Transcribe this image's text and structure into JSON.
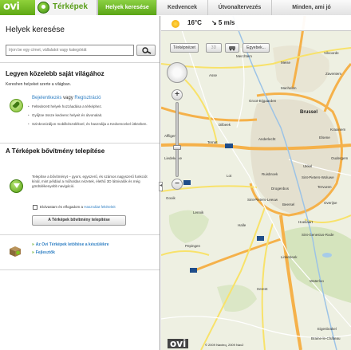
{
  "brand": {
    "logo": "ovi",
    "app_title": "Térképek"
  },
  "tabs": [
    {
      "label": "Helyek keresése",
      "active": true
    },
    {
      "label": "Kedvencek",
      "active": false
    },
    {
      "label": "Útvonaltervezés",
      "active": false
    },
    {
      "label": "Minden, ami jó",
      "active": false
    }
  ],
  "left": {
    "title": "Helyek keresése",
    "search": {
      "placeholder": "írjon be egy címet, vállalatot vagy kategóriát"
    },
    "personal": {
      "heading": "Legyen közelebb saját világához",
      "intro": "Kereshen helyeket szerte a világban.",
      "login": "Bejelentkezés",
      "or": "vagy",
      "register": "Regisztráció",
      "bullets": [
        "Feltedezett helyek hozzáadása a térképhez.",
        "Gyűjtse össze kedvenc helyeit és útvonalait.",
        "Szinkronizáljon mobilkészülékvel, és használja a Kedvencekel útközben."
      ]
    },
    "plugin": {
      "heading": "A Térképek bővítmény telepítése",
      "desc": "Telepítse a bővítményt – gyors, egyszerű, és számos nagyszerű funkciót kínál, mint például a műholdas nézetek, élethű 3D látnivalók és még gördülékenyebb navigáció.",
      "checkbox_prefix": "Elolvastam és elfogadom a",
      "checkbox_link": "Használat feltételeit",
      "button": "A Térképek bővítmény telepítése"
    },
    "download": {
      "link1": "Az Ovi Térképek letöltése a készülékre",
      "link2": "Fejlesztők"
    }
  },
  "map": {
    "weather": {
      "temp": "16°C",
      "wind": "↘ 5 m/s"
    },
    "buttons": [
      "Térképnézet",
      "3D",
      "Egyebek..."
    ],
    "places": [
      "Sint-Pieters-Leeuw",
      "Oudergem",
      "Sint-Pieters-Woluwe",
      "Brussel",
      "Ukkel",
      "Anderlecht",
      "Groot-Bijgaarden",
      "Dilbeek",
      "Elsene",
      "Vilvoorde",
      "Linkebeek",
      "Drogenbos",
      "Beersel",
      "Halle",
      "Lot",
      "Ruisbroek",
      "Sint-Genesius-Rode",
      "Waterloo",
      "Ternat",
      "Affligem",
      "Asse",
      "Merchtem",
      "Meise",
      "Liedekerke",
      "Lennik",
      "Pepingen",
      "Gooik",
      "Eigenbrakel",
      "Braine-le-Château",
      "Zaventem",
      "Machelen",
      "Herent",
      "Tervuren",
      "Overijse",
      "Hoeilaart",
      "Kraainem"
    ],
    "copyright": "© 2009 Navteq, 2009 Nav2",
    "logo": "ovi"
  },
  "colors": {
    "accent": "#5aa515",
    "link": "#2f7fc3"
  }
}
